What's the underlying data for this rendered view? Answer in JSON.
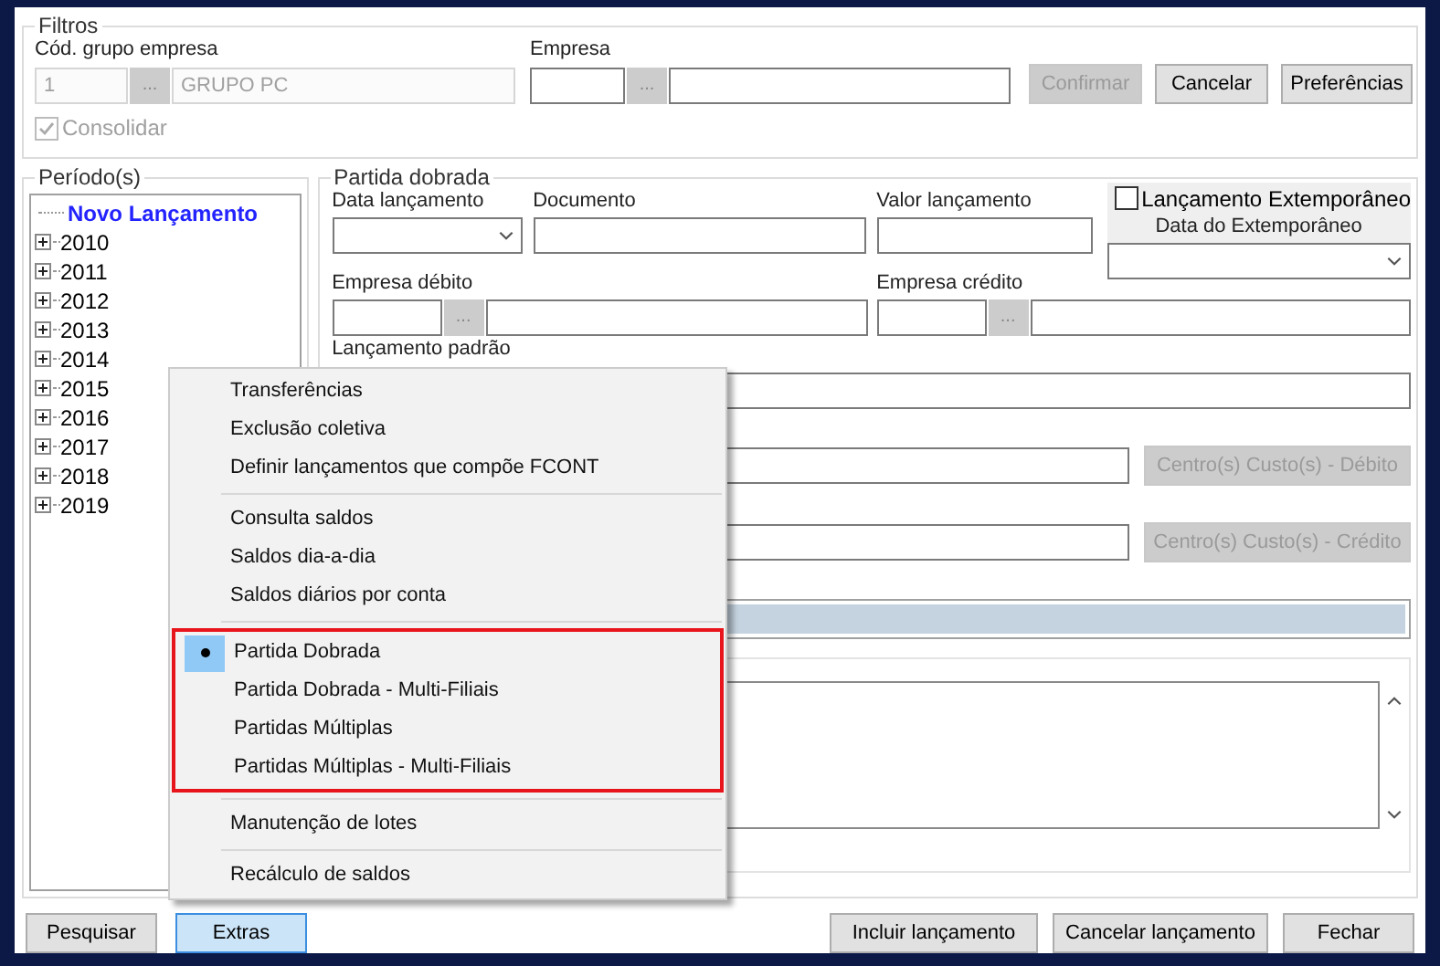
{
  "filters": {
    "title": "Filtros",
    "group_code": {
      "label": "Cód. grupo empresa",
      "value": "1",
      "browse": "...",
      "name": "GRUPO PC",
      "disabled": true
    },
    "company": {
      "label": "Empresa",
      "browse": "..."
    },
    "buttons": [
      {
        "label": "Confirmar",
        "disabled": true
      },
      {
        "label": "Cancelar",
        "disabled": false
      },
      {
        "label": "Preferências",
        "disabled": false
      }
    ],
    "consolidate": {
      "label": "Consolidar",
      "checked": true,
      "disabled": true
    }
  },
  "periods": {
    "title": "Período(s)",
    "items": [
      {
        "label": "Novo Lançamento",
        "kind": "new"
      },
      {
        "label": "2010",
        "kind": "year",
        "expanded": false
      },
      {
        "label": "2011",
        "kind": "year",
        "expanded": false
      },
      {
        "label": "2012",
        "kind": "year",
        "expanded": false
      },
      {
        "label": "2013",
        "kind": "year",
        "expanded": false
      },
      {
        "label": "2014",
        "kind": "year",
        "expanded": false
      },
      {
        "label": "2015",
        "kind": "year",
        "expanded": false
      },
      {
        "label": "2016",
        "kind": "year",
        "expanded": false
      },
      {
        "label": "2017",
        "kind": "year",
        "expanded": false
      },
      {
        "label": "2018",
        "kind": "year",
        "expanded": false
      },
      {
        "label": "2019",
        "kind": "year",
        "expanded": false
      }
    ]
  },
  "entry": {
    "title": "Partida dobrada",
    "date_label": "Data lançamento",
    "document_label": "Documento",
    "value_label": "Valor lançamento",
    "late_entry": {
      "label": "Lançamento Extemporâneo",
      "checked": false,
      "date_label": "Data do Extemporâneo"
    },
    "debit_company": {
      "label": "Empresa débito",
      "browse": "..."
    },
    "credit_company": {
      "label": "Empresa crédito",
      "browse": "..."
    },
    "standard_entry_label": "Lançamento padrão",
    "cost_buttons": [
      {
        "label": "Centro(s) Custo(s) - Débito",
        "disabled": true
      },
      {
        "label": "Centro(s) Custo(s) - Crédito",
        "disabled": true
      }
    ]
  },
  "menu": {
    "groups": [
      {
        "highlighted": false,
        "items": [
          {
            "label": "Transferências",
            "selected": false
          },
          {
            "label": "Exclusão coletiva",
            "selected": false
          },
          {
            "label": "Definir lançamentos que compõe FCONT",
            "selected": false
          }
        ]
      },
      {
        "highlighted": false,
        "items": [
          {
            "label": "Consulta saldos",
            "selected": false
          },
          {
            "label": "Saldos dia-a-dia",
            "selected": false
          },
          {
            "label": "Saldos diários por conta",
            "selected": false
          }
        ]
      },
      {
        "highlighted": true,
        "items": [
          {
            "label": "Partida Dobrada",
            "selected": true
          },
          {
            "label": "Partida Dobrada - Multi-Filiais",
            "selected": false
          },
          {
            "label": "Partidas Múltiplas",
            "selected": false
          },
          {
            "label": "Partidas Múltiplas - Multi-Filiais",
            "selected": false
          }
        ]
      },
      {
        "highlighted": false,
        "items": [
          {
            "label": "Manutenção de lotes",
            "selected": false
          }
        ]
      },
      {
        "highlighted": false,
        "items": [
          {
            "label": "Recálculo de saldos",
            "selected": false
          }
        ]
      }
    ]
  },
  "footer": {
    "left": [
      {
        "label": "Pesquisar",
        "selected": false
      },
      {
        "label": "Extras",
        "selected": true
      }
    ],
    "right": [
      {
        "label": "Incluir lançamento",
        "selected": false
      },
      {
        "label": "Cancelar lançamento",
        "selected": false
      },
      {
        "label": "Fechar",
        "selected": false
      }
    ]
  }
}
